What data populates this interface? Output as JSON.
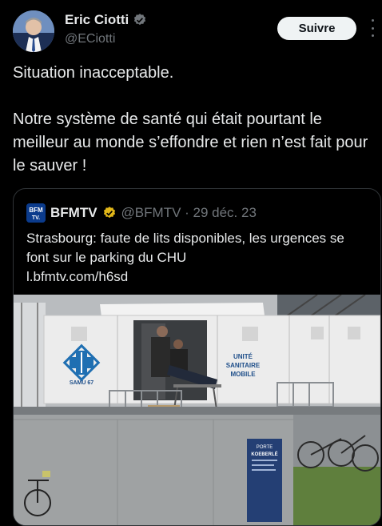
{
  "author": {
    "name": "Eric Ciotti",
    "handle": "@ECiotti",
    "follow_label": "Suivre"
  },
  "tweet": {
    "paragraphs": [
      "Situation inacceptable.",
      "Notre système de santé qui était pourtant le meilleur au monde s’effondre et rien n’est fait pour le sauver !"
    ]
  },
  "quote": {
    "logo_text_top": "BFM",
    "logo_text_bottom": "TV.",
    "name": "BFMTV",
    "meta": "@BFMTV · 29 déc. 23",
    "text": "Strasbourg: faute de lits disponibles, les urgences se font sur le parking du CHU",
    "link": "l.bfmtv.com/h6sd"
  },
  "photo": {
    "samu_label": "SAMU 67",
    "unit_label_line1": "UNITÉ",
    "unit_label_line2": "SANITAIRE",
    "unit_label_line3": "MOBILE",
    "sign_label_line1": "PORTE",
    "sign_label_line2": "KOEBERLÉ"
  },
  "colors": {
    "background": "#000000",
    "text": "#e7e9ea",
    "muted": "#71767b",
    "verified_blue": "#1d9bf0",
    "verified_gold": "#e2b719",
    "bfm_blue": "#0b3b8c"
  }
}
